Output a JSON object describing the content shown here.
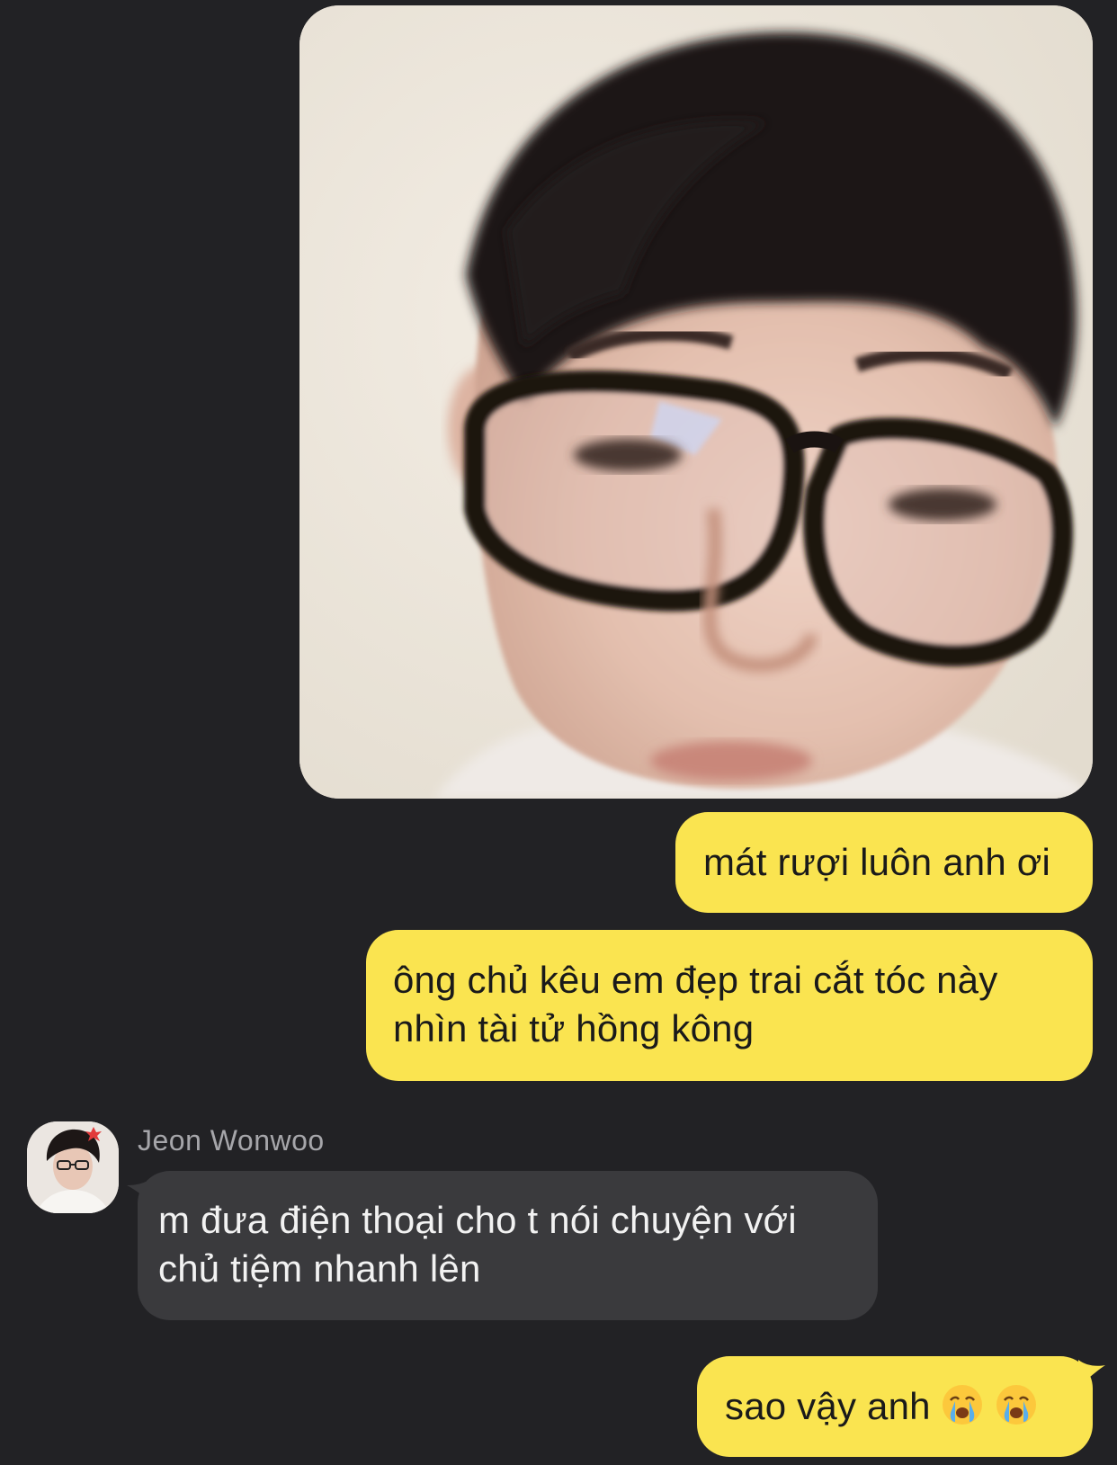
{
  "chat": {
    "messages": [
      {
        "id": "photo",
        "sender": "me",
        "type": "image",
        "image_desc": "selfie photo"
      },
      {
        "id": "b1",
        "sender": "me",
        "lines": [
          "mát rượi luôn anh ơi"
        ]
      },
      {
        "id": "b2",
        "sender": "me",
        "lines": [
          "ông chủ kêu em đẹp trai cắt tóc này",
          "nhìn tài tử hồng kông"
        ]
      },
      {
        "id": "b3",
        "sender": "Jeon Wonwoo",
        "lines": [
          "m đưa điện thoại cho t nói chuyện với",
          "chủ tiệm nhanh lên"
        ]
      },
      {
        "id": "b4",
        "sender": "me",
        "text": "sao vậy anh",
        "emojis": [
          "crying-face-icon",
          "crying-face-icon"
        ]
      }
    ],
    "contact": {
      "name": "Jeon Wonwoo"
    }
  },
  "colors": {
    "background": "#222225",
    "my_bubble": "#fae450",
    "their_bubble": "#3a3a3d",
    "sender_name": "#a6a6aa"
  }
}
